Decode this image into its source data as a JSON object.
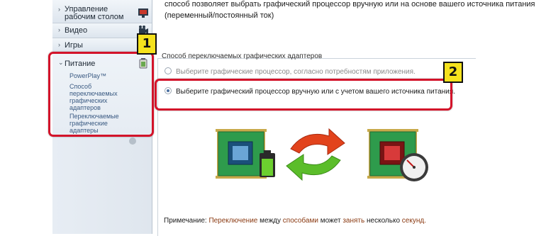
{
  "header": {
    "description_line1": "способ позволяет выбрать графический процессор вручную или на основе вашего источника питания",
    "description_line2": "(переменный/постоянный ток)"
  },
  "sidebar": {
    "items": [
      {
        "label_line1": "Управление",
        "label_line2": "рабочим столом",
        "icon": "desktop-icon",
        "expanded": false
      },
      {
        "label": "Видео",
        "icon": "video-icon",
        "expanded": false
      },
      {
        "label": "Игры",
        "icon": "games-icon",
        "expanded": false
      },
      {
        "label": "Питание",
        "icon": "battery-icon",
        "expanded": true,
        "children": [
          {
            "label": "PowerPlay™"
          },
          {
            "label": "Способ переключаемых графических адаптеров"
          },
          {
            "label": "Переключаемые графические адаптеры"
          }
        ]
      }
    ]
  },
  "main": {
    "group_title": "Способ переключаемых графических адаптеров",
    "options": [
      {
        "label": "Выберите графические процессор, согласно потребностям приложения.",
        "selected": false,
        "disabled": true
      },
      {
        "label": "Выберите графический процессор вручную или с учетом вашего источника питания.",
        "selected": true,
        "disabled": false
      }
    ],
    "illustration": {
      "left_icon": "gpu-chip-battery-icon",
      "middle_icon": "switch-arrows-icon",
      "right_icon": "gpu-chip-performance-icon"
    },
    "note": {
      "prefix": "Примечание: ",
      "part1": "Переключение ",
      "part2": "между ",
      "part3": "способами ",
      "part4": "может ",
      "part5": "занять ",
      "part6": "несколько ",
      "part7": "секунд."
    }
  },
  "annotations": [
    {
      "number": "1"
    },
    {
      "number": "2"
    }
  ],
  "colors": {
    "callout_red": "#d3132a",
    "badge_yellow": "#f5e21d",
    "chip_green": "#2e9b4c",
    "arrow_red": "#e2431c",
    "arrow_green": "#5bbd2a"
  }
}
